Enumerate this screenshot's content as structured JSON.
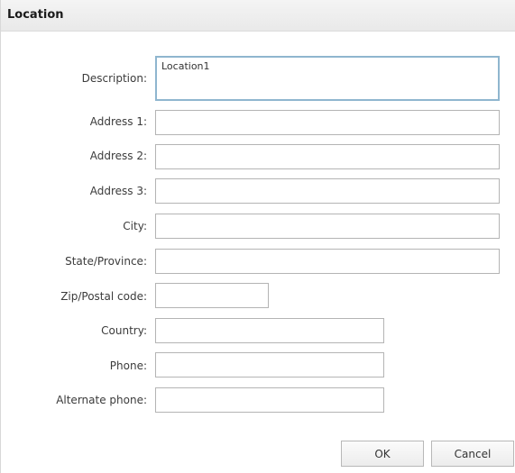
{
  "dialog": {
    "title": "Location"
  },
  "fields": {
    "description": {
      "label": "Description:",
      "value": "Location1"
    },
    "address1": {
      "label": "Address 1:",
      "value": ""
    },
    "address2": {
      "label": "Address 2:",
      "value": ""
    },
    "address3": {
      "label": "Address 3:",
      "value": ""
    },
    "city": {
      "label": "City:",
      "value": ""
    },
    "state": {
      "label": "State/Province:",
      "value": ""
    },
    "zip": {
      "label": "Zip/Postal code:",
      "value": ""
    },
    "country": {
      "label": "Country:",
      "value": ""
    },
    "phone": {
      "label": "Phone:",
      "value": ""
    },
    "alt_phone": {
      "label": "Alternate phone:",
      "value": ""
    }
  },
  "buttons": {
    "ok": "OK",
    "cancel": "Cancel"
  }
}
